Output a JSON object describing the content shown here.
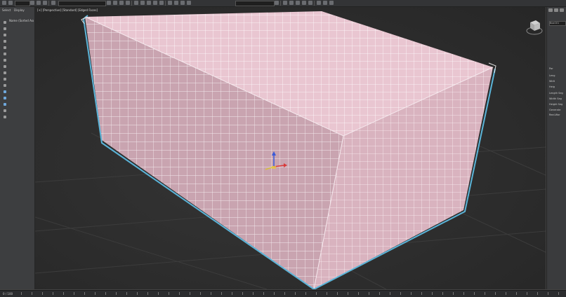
{
  "toolbar": {
    "layer_field": "",
    "selection_set_field": "",
    "icons": [
      "undo-icon",
      "redo-icon",
      "link-icon",
      "unlink-icon",
      "bind-icon",
      "select-icon",
      "select-by-name-icon",
      "region-icon",
      "window-crossing-icon",
      "move-icon",
      "rotate-icon",
      "scale-icon",
      "reference-coord-icon",
      "pivot-icon",
      "snap-icon",
      "angle-snap-icon",
      "percent-snap-icon",
      "spinner-snap-icon",
      "named-selection-icon",
      "mirror-icon",
      "align-icon",
      "layer-icon",
      "curve-editor-icon",
      "schematic-icon",
      "material-editor-icon",
      "render-setup-icon",
      "render-frame-icon",
      "render-icon"
    ]
  },
  "explorer": {
    "tab_select": "Select",
    "tab_display": "Display",
    "tree_header": "Name (Sorted Ascen",
    "icons": [
      "display-all-icon",
      "geometry-icon",
      "shapes-icon",
      "lights-icon",
      "cameras-icon",
      "helpers-icon",
      "spacewarps-icon",
      "groups-icon",
      "xrefs-icon",
      "bones-icon",
      "containers-icon",
      "frozen-icon",
      "hidden-icon",
      "layers-icon",
      "filter-icon",
      "lock-icon"
    ]
  },
  "viewport": {
    "label": "[+] [Perspective] [Standard] [Edged Faces]",
    "navigation": "viewcube-icon",
    "object_color": "#e8b9c8",
    "selection_bracket_color": "#5bb4d8",
    "grid_color": "#3a3a3a",
    "gizmo_icon": "transform-gizmo-icon"
  },
  "command_panel": {
    "name_field": "Box001",
    "rows": [
      "Par",
      "Leng",
      "Widt",
      "Heig",
      "Length Seg",
      "Width Seg",
      "Height Seg",
      "Generate",
      "Real-Wor"
    ]
  },
  "timeline": {
    "frame_label": "0 / 100"
  }
}
